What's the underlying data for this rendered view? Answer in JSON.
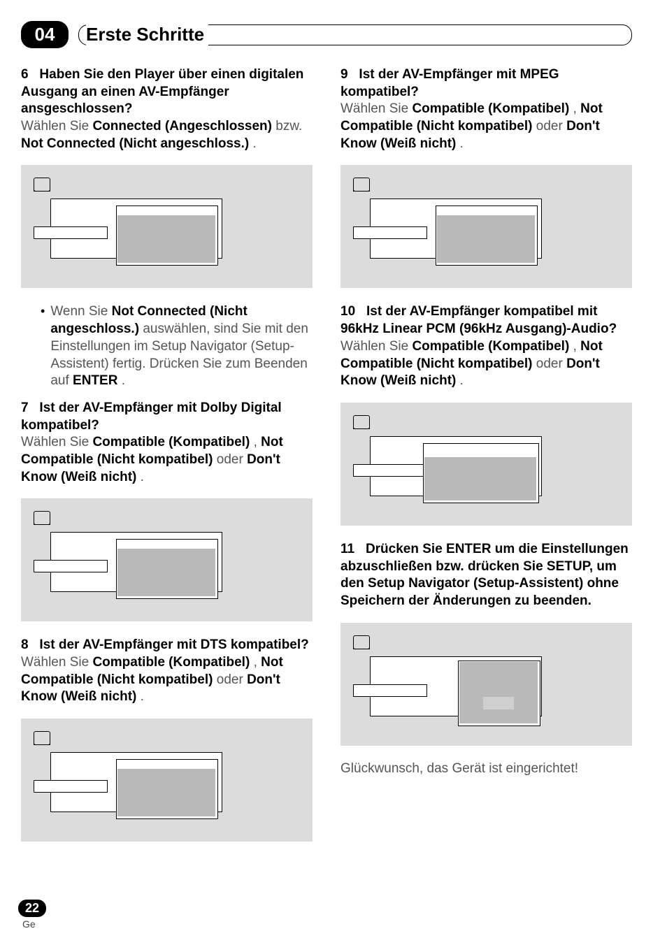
{
  "chapter_number": "04",
  "chapter_title": "Erste Schritte",
  "page_number": "22",
  "language_code": "Ge",
  "congrats": "Glückwunsch, das Gerät ist eingerichtet!",
  "left": {
    "s6": {
      "num": "6",
      "q": "Haben Sie den Player über einen digitalen Ausgang an einen AV-Empfänger ansgeschlossen?",
      "a_pre": "Wählen Sie ",
      "a_b1": "Connected (Angeschlossen)",
      "a_mid": " bzw. ",
      "a_b2": "Not Connected (Nicht angeschloss.)",
      "a_post": "."
    },
    "bullet": {
      "pre": "Wenn Sie ",
      "b": "Not Connected (Nicht angeschloss.)",
      "mid": " auswählen, sind Sie mit den Einstellungen im Setup Navigator (Setup-Assistent) fertig. Drücken Sie zum Beenden auf ",
      "b2": "ENTER",
      "post": "."
    },
    "s7": {
      "num": "7",
      "q": "Ist der AV-Empfänger mit Dolby Digital kompatibel?",
      "a_pre": "Wählen Sie ",
      "a_b1": "Compatible (Kompatibel)",
      "a_mid1": ", ",
      "a_b2": "Not Compatible (Nicht kompatibel)",
      "a_mid2": " oder ",
      "a_b3": "Don't Know (Weiß nicht)",
      "a_post": "."
    },
    "s8": {
      "num": "8",
      "q": "Ist der AV-Empfänger mit DTS kompatibel?",
      "a_pre": "Wählen Sie ",
      "a_b1": "Compatible (Kompatibel)",
      "a_mid1": ", ",
      "a_b2": "Not Compatible (Nicht kompatibel)",
      "a_mid2": " oder ",
      "a_b3": "Don't Know (Weiß nicht)",
      "a_post": "."
    }
  },
  "right": {
    "s9": {
      "num": "9",
      "q": "Ist der AV-Empfänger mit MPEG kompatibel?",
      "a_pre": "Wählen Sie ",
      "a_b1": "Compatible (Kompatibel)",
      "a_mid1": ", ",
      "a_b2": "Not Compatible (Nicht kompatibel)",
      "a_mid2": " oder ",
      "a_b3": "Don't Know (Weiß nicht)",
      "a_post": "."
    },
    "s10": {
      "num": "10",
      "q": "Ist der AV-Empfänger kompatibel mit 96kHz Linear PCM (96kHz Ausgang)-Audio?",
      "a_pre": "Wählen Sie ",
      "a_b1": "Compatible (Kompatibel)",
      "a_mid1": ", ",
      "a_b2": "Not Compatible (Nicht kompatibel)",
      "a_mid2": " oder ",
      "a_b3": "Don't Know (Weiß nicht)",
      "a_post": "."
    },
    "s11": {
      "num": "11",
      "q": "Drücken Sie ENTER um die Einstellungen abzuschließen bzw. drücken Sie SETUP, um den Setup Navigator (Setup-Assistent) ohne Speichern der Änderungen zu beenden."
    }
  }
}
